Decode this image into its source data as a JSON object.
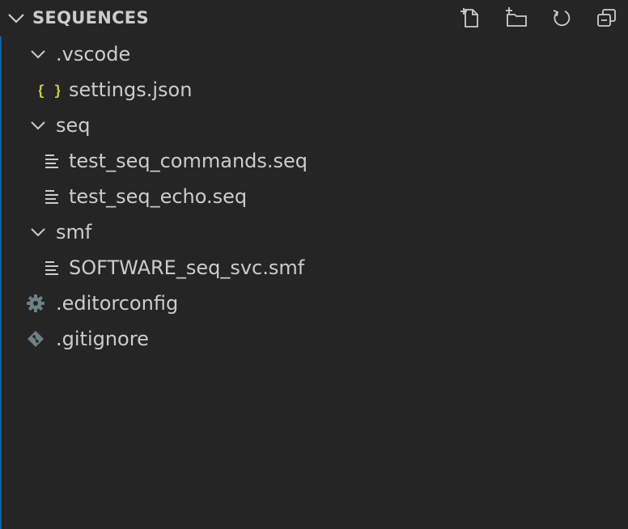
{
  "header": {
    "title": "SEQUENCES",
    "actions": [
      {
        "name": "new-file",
        "tooltip": "New File"
      },
      {
        "name": "new-folder",
        "tooltip": "New Folder"
      },
      {
        "name": "refresh",
        "tooltip": "Refresh Explorer"
      },
      {
        "name": "collapse-all",
        "tooltip": "Collapse Folders in Explorer"
      }
    ]
  },
  "tree": {
    "items": [
      {
        "label": ".vscode",
        "type": "folder",
        "expanded": true,
        "icon": "chevron-down-icon"
      },
      {
        "label": "settings.json",
        "type": "file",
        "icon": "json-braces-icon"
      },
      {
        "label": "seq",
        "type": "folder",
        "expanded": true,
        "icon": "chevron-down-icon"
      },
      {
        "label": "test_seq_commands.seq",
        "type": "file",
        "icon": "text-lines-icon"
      },
      {
        "label": "test_seq_echo.seq",
        "type": "file",
        "icon": "text-lines-icon"
      },
      {
        "label": "smf",
        "type": "folder",
        "expanded": true,
        "icon": "chevron-down-icon"
      },
      {
        "label": "SOFTWARE_seq_svc.smf",
        "type": "file",
        "icon": "text-lines-icon"
      },
      {
        "label": ".editorconfig",
        "type": "file",
        "icon": "gear-icon"
      },
      {
        "label": ".gitignore",
        "type": "file",
        "icon": "git-diamond-icon"
      }
    ]
  },
  "colors": {
    "background": "#252526",
    "text": "#cccccc",
    "json_icon": "#cbcb41",
    "muted_icon": "#6d8086",
    "focus_border": "#0e639c"
  }
}
